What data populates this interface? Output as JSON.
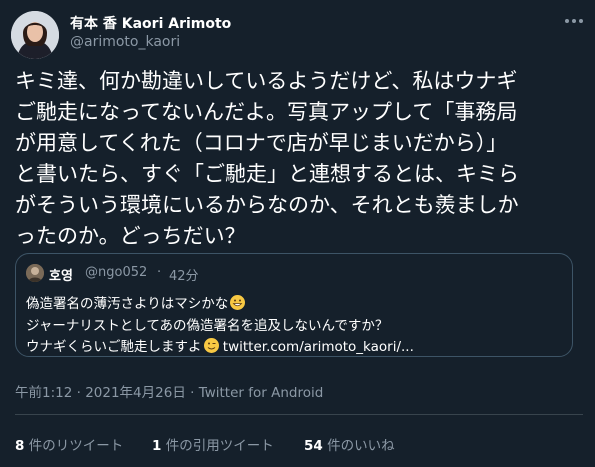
{
  "author": {
    "display_name": "有本 香 Kaori Arimoto",
    "handle": "@arimoto_kaori"
  },
  "tweet": {
    "lines": [
      "キミ達、何か勘違いしているようだけど、私はウナギ",
      "ご馳走になってないんだよ。写真アップして「事務局",
      "が用意してくれた（コロナで店が早じまいだから）」",
      "と書いたら、すぐ「ご馳走」と連想するとは、キミら",
      "がそういう環境にいるからなのか、それとも羨ましか",
      "ったのか。どっちだい？"
    ]
  },
  "quote": {
    "name": "호영",
    "handle": "@ngo052",
    "separator": "·",
    "time": "42分",
    "line1": "偽造署名の薄汚さよりはマシかな",
    "line2": "ジャーナリストとしてあの偽造署名を追及しないんですか？",
    "line3_text": "ウナギくらいご馳走しますよ",
    "line3_link": "twitter.com/arimoto_kaori/...",
    "emoji1": "grinning-face-icon",
    "emoji2": "winking-face-icon"
  },
  "meta": {
    "timestamp": "午前1:12 · 2021年4月26日 · ",
    "source": "Twitter for Android"
  },
  "stats": {
    "retweets_count": "8",
    "retweets_label": "件のリツイート",
    "quotes_count": "1",
    "quotes_label": "件の引用ツイート",
    "likes_count": "54",
    "likes_label": "件のいいね"
  },
  "colors": {
    "background": "#15202b",
    "text_primary": "#ffffff",
    "text_secondary": "#8b98a5",
    "border": "#38444d"
  }
}
